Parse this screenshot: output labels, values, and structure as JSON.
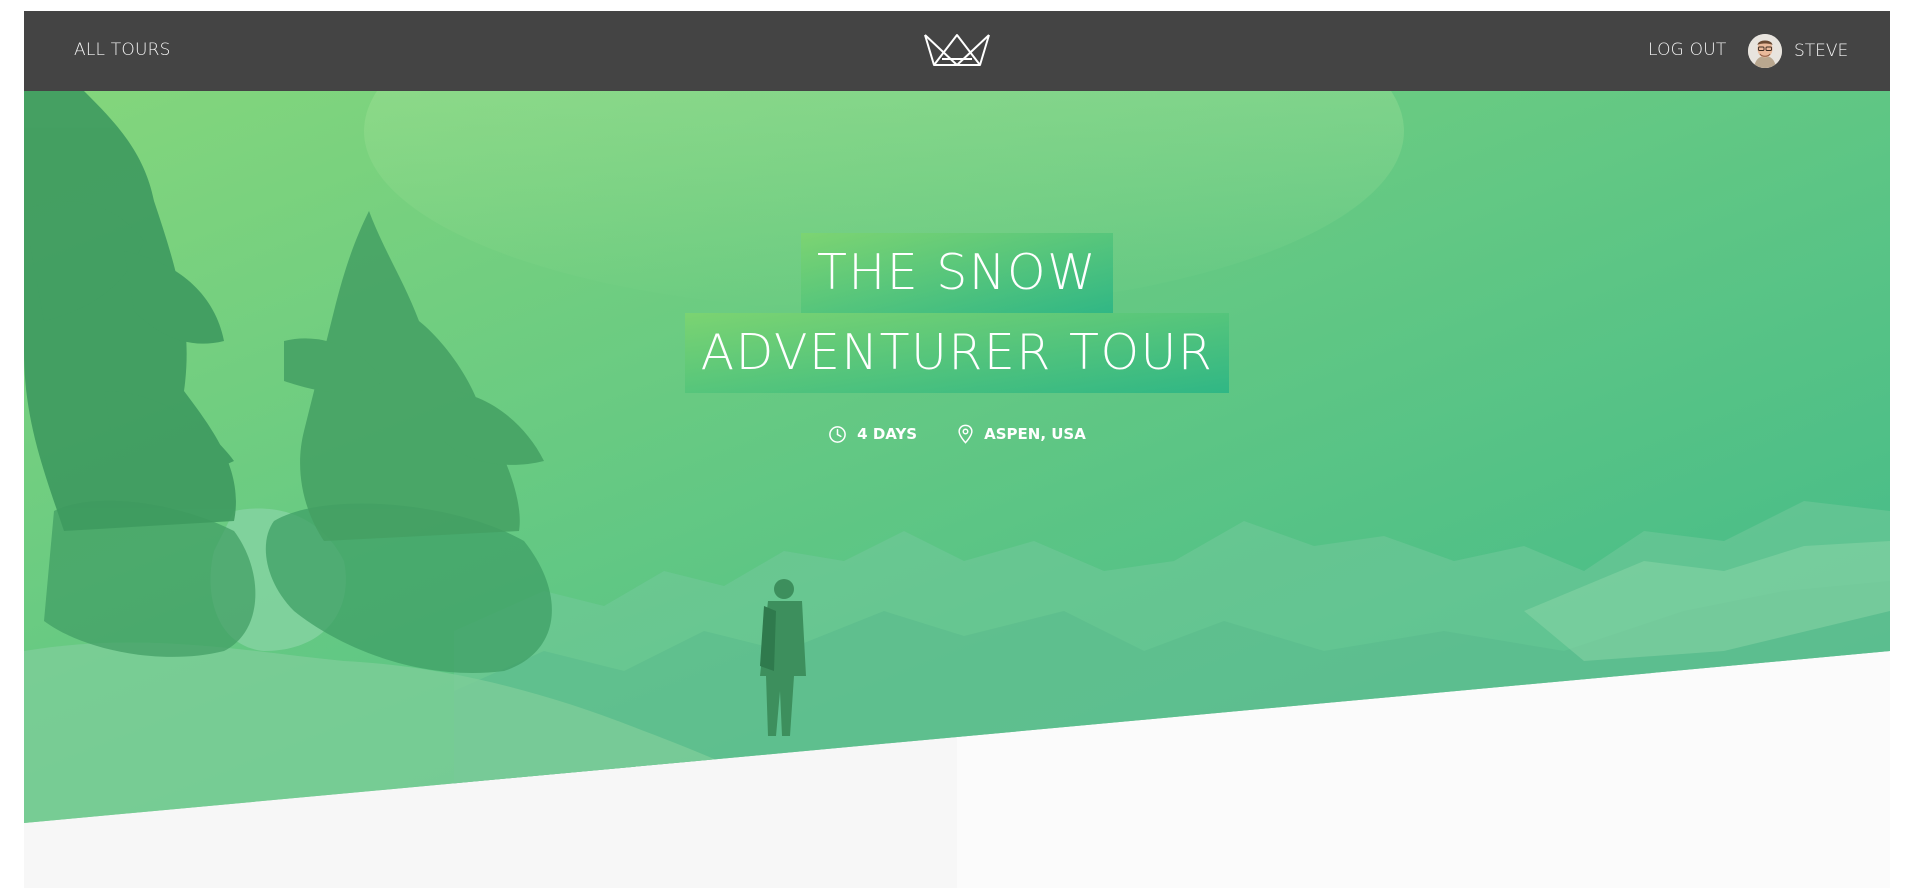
{
  "header": {
    "all_tours_label": "All Tours",
    "logout_label": "Log out",
    "user_name": "Steve",
    "logo_icon": "crown-logo-icon"
  },
  "hero": {
    "title_line_1": "The Snow",
    "title_line_2": "Adventurer Tour",
    "details": [
      {
        "icon": "clock-icon",
        "text": "4 days"
      },
      {
        "icon": "map-pin-icon",
        "text": "Aspen, USA"
      }
    ]
  },
  "colors": {
    "header_bg": "#444444",
    "hero_gradient_start": "#7ed56f",
    "hero_gradient_end": "#28b485",
    "page_bg_left": "#f7f7f7",
    "page_bg_right": "#fbfbfb"
  }
}
